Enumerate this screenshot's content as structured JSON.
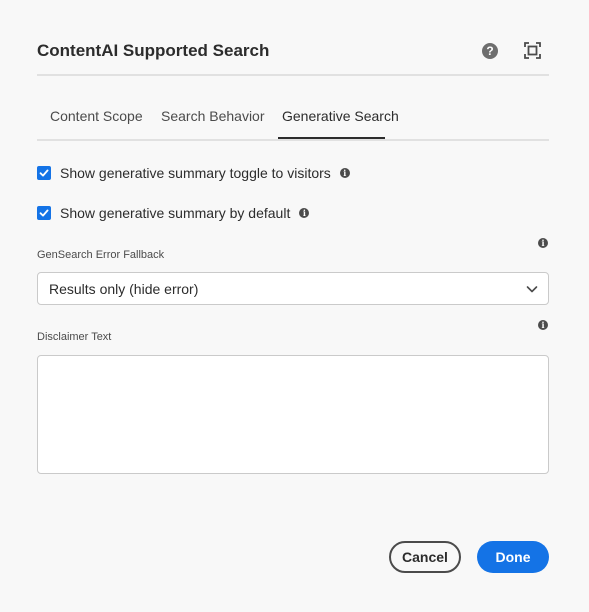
{
  "dialog": {
    "title": "ContentAI Supported Search",
    "help_symbol": "?"
  },
  "tabs": [
    {
      "label": "Content Scope",
      "selected": false
    },
    {
      "label": "Search Behavior",
      "selected": false
    },
    {
      "label": "Generative Search",
      "selected": true
    }
  ],
  "options": {
    "show_toggle": {
      "label": "Show generative summary toggle to visitors",
      "checked": true
    },
    "show_default": {
      "label": "Show generative summary by default",
      "checked": true
    }
  },
  "fallback": {
    "label": "GenSearch Error Fallback",
    "value": "Results only (hide error)"
  },
  "disclaimer": {
    "label": "Disclaimer Text",
    "value": ""
  },
  "info_symbol": "i",
  "buttons": {
    "cancel": "Cancel",
    "done": "Done"
  },
  "colors": {
    "accent": "#1473e6",
    "background": "#f8f8f8"
  },
  "icons": {
    "help": "help-icon",
    "fullscreen": "fullscreen-icon",
    "info": "info-icon",
    "checkmark": "checkmark-icon",
    "chevron": "chevron-down-icon"
  }
}
